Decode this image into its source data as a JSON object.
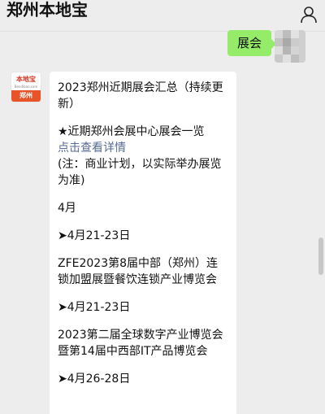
{
  "header": {
    "title": "郑州本地宝"
  },
  "outgoing": {
    "text": "展会"
  },
  "brand": {
    "logo_top": "本地宝",
    "logo_sub": "Bendibao.com",
    "logo_city": "郑州"
  },
  "message": {
    "title": "2023郑州近期展会汇总（持续更新）",
    "section": "★近期郑州会展中心展会一览",
    "link": "点击查看详情",
    "note": "(注：商业计划，以实际举办展览为准)",
    "month": "4月",
    "events": [
      {
        "date": "➤4月21-23日",
        "name": "ZFE2023第8届中部（郑州）连锁加盟展暨餐饮连锁产业博览会"
      },
      {
        "date": "➤4月21-23日",
        "name": "2023第二届全球数字产业博览会暨第14届中西部IT产品博览会"
      },
      {
        "date": "➤4月26-28日",
        "name": ""
      }
    ]
  },
  "colors": {
    "background": "#ededed",
    "outgoing_bubble": "#95ec69",
    "incoming_bubble": "#ffffff",
    "link": "#576b95",
    "brand_red": "#d8331f",
    "brand_orange": "#e8532a"
  },
  "icons": {
    "profile": "user-icon"
  }
}
